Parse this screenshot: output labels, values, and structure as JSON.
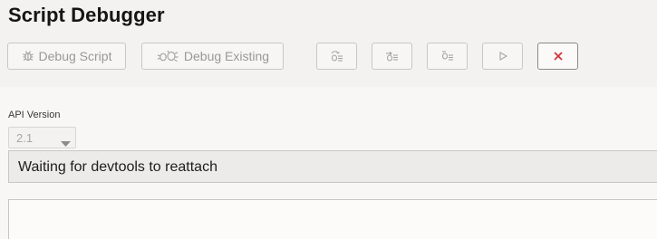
{
  "page": {
    "title": "Script Debugger"
  },
  "toolbar": {
    "debug_script_label": "Debug Script",
    "debug_existing_label": "Debug Existing",
    "icons": [
      "bug-icon",
      "bugs-icon",
      "step-over-icon",
      "step-into-icon",
      "step-out-icon",
      "play-icon",
      "close-icon"
    ]
  },
  "api_version": {
    "label": "API Version",
    "selected": "2.1"
  },
  "status": {
    "message": "Waiting for devtools to reattach"
  },
  "colors": {
    "close_icon": "#d0343a",
    "disabled_text": "#9a9893"
  }
}
